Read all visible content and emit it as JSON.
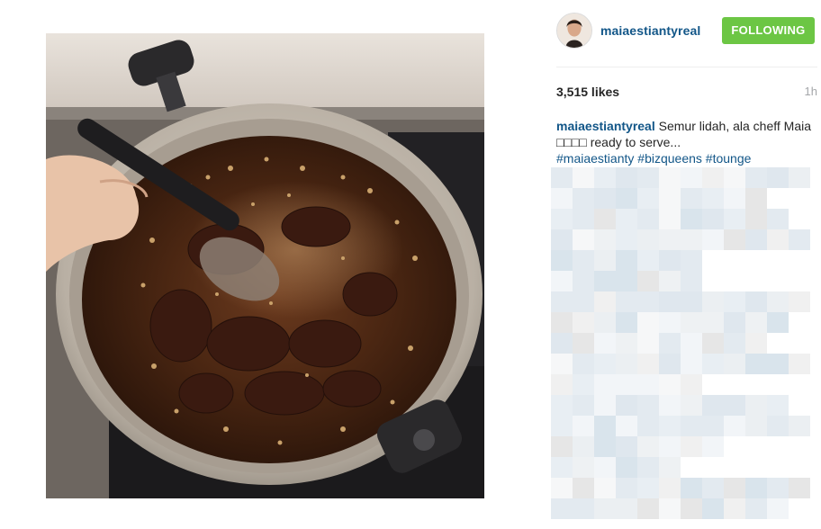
{
  "post": {
    "username": "maiaestiantyreal",
    "follow_label": "FOLLOWING",
    "likes": "3,515 likes",
    "time": "1h",
    "caption": {
      "username": "maiaestiantyreal",
      "text": "Semur lidah, ala cheff Maia □□□□ ready to serve...",
      "hashtags": [
        "#maiaestianty",
        "#bizqueens",
        "#tounge"
      ]
    }
  },
  "colors": {
    "link_blue": "#125688",
    "follow_green": "#6cc644",
    "muted": "#a5a7aa"
  },
  "icons": [
    "avatar-photo",
    "food-photo"
  ]
}
